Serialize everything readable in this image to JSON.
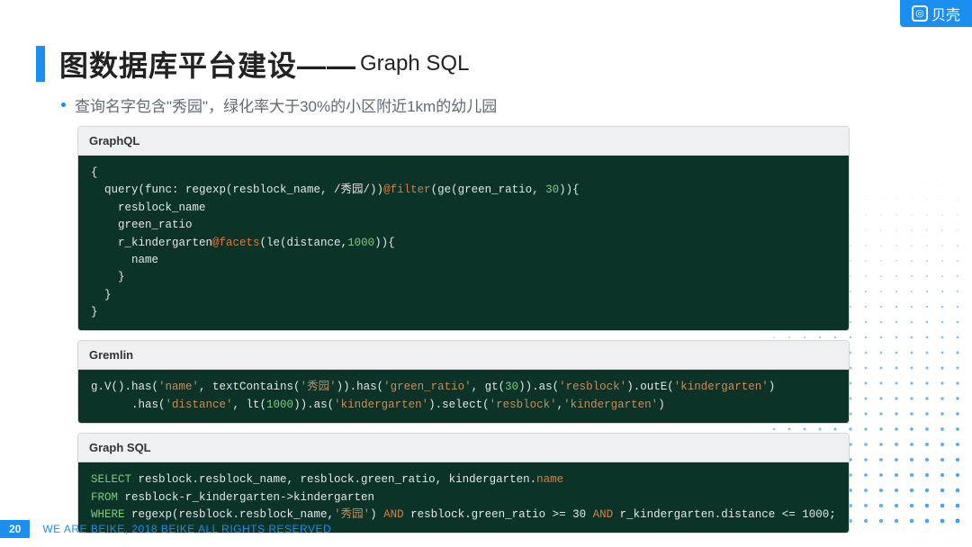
{
  "logo": {
    "icon": "◎",
    "text": "贝壳"
  },
  "title": {
    "cn": "图数据库平台建设——",
    "suffix": "Graph SQL"
  },
  "bullet": "查询名字包含\"秀园\"，绿化率大于30%的小区附近1km的幼儿园",
  "panels": {
    "graphql": {
      "label": "GraphQL",
      "line1a": "{",
      "line2a": "  query(func: regexp(resblock_name, /秀园/))",
      "line2b": "@filter",
      "line2c": "(ge(green_ratio, ",
      "line2d": "30",
      "line2e": ")){",
      "line3": "    resblock_name",
      "line4": "    green_ratio",
      "line5a": "    r_kindergarten",
      "line5b": "@facets",
      "line5c": "(le(distance,",
      "line5d": "1000",
      "line5e": ")){",
      "line6": "      name",
      "line7": "    }",
      "line8": "  }",
      "line9": "}"
    },
    "gremlin": {
      "label": "Gremlin",
      "l1a": "g.V().has(",
      "l1b": "'name'",
      "l1c": ", textContains(",
      "l1d": "'秀园'",
      "l1e": ")).has(",
      "l1f": "'green_ratio'",
      "l1g": ", gt(",
      "l1h": "30",
      "l1i": ")).as(",
      "l1j": "'resblock'",
      "l1k": ").outE(",
      "l1l": "'kindergarten'",
      "l1m": ")",
      "l2a": "      .has(",
      "l2b": "'distance'",
      "l2c": ", lt(",
      "l2d": "1000",
      "l2e": ")).as(",
      "l2f": "'kindergarten'",
      "l2g": ").select(",
      "l2h": "'resblock'",
      "l2i": ",",
      "l2j": "'kindergarten'",
      "l2k": ")"
    },
    "graphsql": {
      "label": "Graph SQL",
      "s1a": "SELECT",
      "s1b": " resblock.resblock_name, resblock.green_ratio, kindergarten.",
      "s1c": "name",
      "s2a": "FROM",
      "s2b": " resblock-r_kindergarten->kindergarten",
      "s3a": "WHERE",
      "s3b": " regexp(resblock.resblock_name,",
      "s3c": "'秀园'",
      "s3d": ") ",
      "s3e": "AND",
      "s3f": " resblock.green_ratio >= 30 ",
      "s3g": "AND",
      "s3h": " r_kindergarten.distance <= 1000;"
    }
  },
  "footer": {
    "page": "20",
    "text": "WE ARE BEIKE, 2018 BEIKE ALL RIGHTS RESERVED"
  }
}
